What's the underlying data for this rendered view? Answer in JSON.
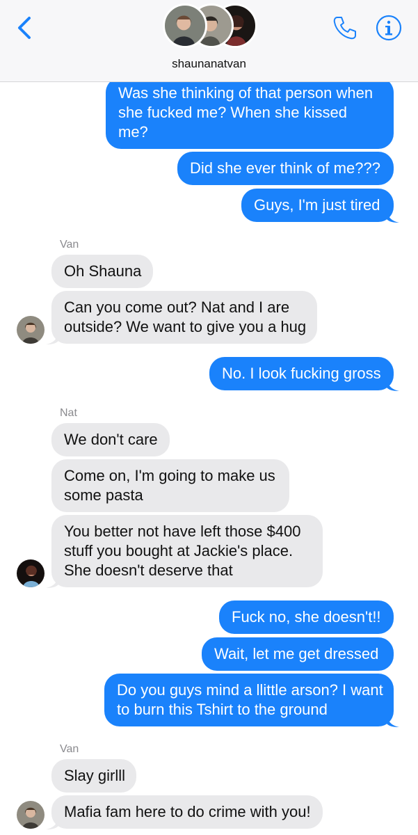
{
  "header": {
    "title": "shaunanatvan",
    "colors": {
      "accent": "#1a82fb",
      "outgoing": "#1a82fb",
      "incoming": "#e9e9eb"
    }
  },
  "messages": [
    {
      "dir": "out",
      "lines": [
        "Was she thinking of that person when",
        "she fucked me? When she kissed",
        "me?"
      ]
    },
    {
      "dir": "out",
      "lines": [
        "Did she ever think of me???"
      ]
    },
    {
      "dir": "out",
      "lines": [
        "Guys, I'm just tired"
      ]
    },
    {
      "sender": "Van"
    },
    {
      "dir": "in",
      "lines": [
        "Oh Shauna"
      ]
    },
    {
      "dir": "in",
      "lines": [
        "Can you come out? Nat and I are",
        "outside? We want to give you a hug"
      ]
    },
    {
      "dir": "out",
      "lines": [
        "No. I look fucking gross"
      ]
    },
    {
      "sender": "Nat"
    },
    {
      "dir": "in",
      "lines": [
        "We don't care"
      ]
    },
    {
      "dir": "in",
      "lines": [
        "Come on, I'm going to make us",
        "some pasta"
      ]
    },
    {
      "dir": "in",
      "lines": [
        "You better not have left those $400",
        "stuff you bought at Jackie's place.",
        "She doesn't deserve that"
      ]
    },
    {
      "dir": "out",
      "lines": [
        "Fuck no, she doesn't!!"
      ]
    },
    {
      "dir": "out",
      "lines": [
        "Wait, let me get dressed"
      ]
    },
    {
      "dir": "out",
      "lines": [
        "Do you guys mind a llittle arson? I want",
        "to burn this Tshirt to the ground"
      ]
    },
    {
      "sender": "Van"
    },
    {
      "dir": "in",
      "lines": [
        "Slay girlll"
      ]
    },
    {
      "dir": "in",
      "lines": [
        "Mafia fam here to do crime with you!"
      ]
    }
  ]
}
